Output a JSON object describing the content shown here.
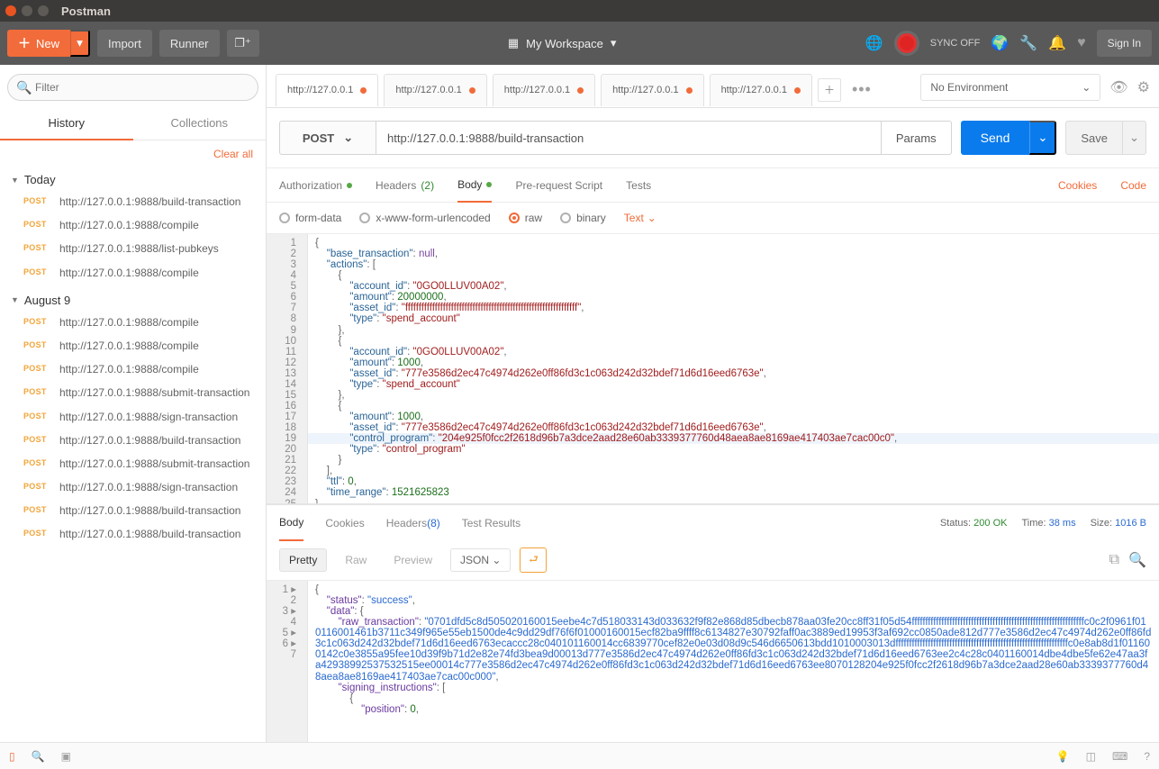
{
  "window": {
    "title": "Postman"
  },
  "topbar": {
    "new": "New",
    "import": "Import",
    "runner": "Runner",
    "workspace": "My Workspace",
    "sync": "SYNC OFF",
    "signin": "Sign In"
  },
  "sidebar": {
    "filter_placeholder": "Filter",
    "tabs": {
      "history": "History",
      "collections": "Collections"
    },
    "clear_all": "Clear all",
    "groups": [
      {
        "label": "Today",
        "items": [
          {
            "method": "POST",
            "url": "http://127.0.0.1:9888/build-transaction"
          },
          {
            "method": "POST",
            "url": "http://127.0.0.1:9888/compile"
          },
          {
            "method": "POST",
            "url": "http://127.0.0.1:9888/list-pubkeys"
          },
          {
            "method": "POST",
            "url": "http://127.0.0.1:9888/compile"
          }
        ]
      },
      {
        "label": "August 9",
        "items": [
          {
            "method": "POST",
            "url": "http://127.0.0.1:9888/compile"
          },
          {
            "method": "POST",
            "url": "http://127.0.0.1:9888/compile"
          },
          {
            "method": "POST",
            "url": "http://127.0.0.1:9888/compile"
          },
          {
            "method": "POST",
            "url": "http://127.0.0.1:9888/submit-transaction"
          },
          {
            "method": "POST",
            "url": "http://127.0.0.1:9888/sign-transaction"
          },
          {
            "method": "POST",
            "url": "http://127.0.0.1:9888/build-transaction"
          },
          {
            "method": "POST",
            "url": "http://127.0.0.1:9888/submit-transaction"
          },
          {
            "method": "POST",
            "url": "http://127.0.0.1:9888/sign-transaction"
          },
          {
            "method": "POST",
            "url": "http://127.0.0.1:9888/build-transaction"
          },
          {
            "method": "POST",
            "url": "http://127.0.0.1:9888/build-transaction"
          }
        ]
      }
    ]
  },
  "tabs": [
    {
      "label": "http://127.0.0.1",
      "dirty": true,
      "active": true
    },
    {
      "label": "http://127.0.0.1",
      "dirty": true
    },
    {
      "label": "http://127.0.0.1",
      "dirty": true
    },
    {
      "label": "http://127.0.0.1",
      "dirty": true
    },
    {
      "label": "http://127.0.0.1",
      "dirty": true
    }
  ],
  "environment": {
    "selected": "No Environment"
  },
  "request": {
    "method": "POST",
    "url": "http://127.0.0.1:9888/build-transaction",
    "params_btn": "Params",
    "send": "Send",
    "save": "Save",
    "tabs": {
      "authorization": "Authorization",
      "headers": "Headers",
      "headers_count": "(2)",
      "body": "Body",
      "prerequest": "Pre-request Script",
      "tests": "Tests",
      "cookies": "Cookies",
      "code": "Code"
    },
    "body_type": {
      "formdata": "form-data",
      "xform": "x-www-form-urlencoded",
      "raw": "raw",
      "binary": "binary",
      "text_dd": "Text"
    },
    "body_lines": [
      "{",
      "    \"base_transaction\": null,",
      "    \"actions\": [",
      "        {",
      "            \"account_id\": \"0GO0LLUV00A02\",",
      "            \"amount\": 20000000,",
      "            \"asset_id\": \"ffffffffffffffffffffffffffffffffffffffffffffffffffffffffffffffff\",",
      "            \"type\": \"spend_account\"",
      "        },",
      "        {",
      "            \"account_id\": \"0GO0LLUV00A02\",",
      "            \"amount\": 1000,",
      "            \"asset_id\": \"777e3586d2ec47c4974d262e0ff86fd3c1c063d242d32bdef71d6d16eed6763e\",",
      "            \"type\": \"spend_account\"",
      "        },",
      "        {",
      "            \"amount\": 1000,",
      "            \"asset_id\": \"777e3586d2ec47c4974d262e0ff86fd3c1c063d242d32bdef71d6d16eed6763e\",",
      "            \"control_program\": \"204e925f0fcc2f2618d96b7a3dce2aad28e60ab3339377760d48aea8ae8169ae417403ae7cac00c0\",",
      "            \"type\": \"control_program\"",
      "        }",
      "    ],",
      "    \"ttl\": 0,",
      "    \"time_range\": 1521625823",
      "}"
    ]
  },
  "response": {
    "tabs": {
      "body": "Body",
      "cookies": "Cookies",
      "headers": "Headers",
      "headers_count": "(8)",
      "tests": "Test Results"
    },
    "status_label": "Status:",
    "status_value": "200 OK",
    "time_label": "Time:",
    "time_value": "38 ms",
    "size_label": "Size:",
    "size_value": "1016 B",
    "view": {
      "pretty": "Pretty",
      "raw": "Raw",
      "preview": "Preview",
      "fmt": "JSON"
    },
    "lines": [
      "{",
      "    \"status\": \"success\",",
      "    \"data\": {",
      "        \"raw_transaction\": \"0701dfd5c8d505020160015eebe4c7d518033143d033632f9f82e868d85dbecb878aa03fe20cc8ff31f05d54ffffffffffffffffffffffffffffffffffffffffffffffffffffffffffffffffc0c2f0961f010116001461b3711c349f965e55eb1500de4c9dd29df76f6f01000160015ecf82ba9ffff8c6134827e30792faff0ac3889ed19953f3af692cc0850ade812d777e3586d2ec47c4974d262e0ff86fd3c1c063d242d32bdef71d6d16eed6763ecaccc28c040101160014cc6839770cef82e0e03d08d9c546d6650613bdd1010003013dffffffffffffffffffffffffffffffffffffffffffffffffffffffffffffffffc0e8ab8d1f011600142c0e3855a95fee10d39f9b71d2e82e74fd3bea9d00013d777e3586d2ec47c4974d262e0ff86fd3c1c063d242d32bdef71d6d16eed6763ee2c4c28c0401160014dbe4dbe5fe62e47aa3fa42938992537532515ee00014c777e3586d2ec47c4974d262e0ff86fd3c1c063d242d32bdef71d6d16eed6763ee8070128204e925f0fcc2f2618d96b7a3dce2aad28e60ab3339377760d48aea8ae8169ae417403ae7cac00c000\",",
      "        \"signing_instructions\": [",
      "            {",
      "                \"position\": 0,"
    ]
  }
}
